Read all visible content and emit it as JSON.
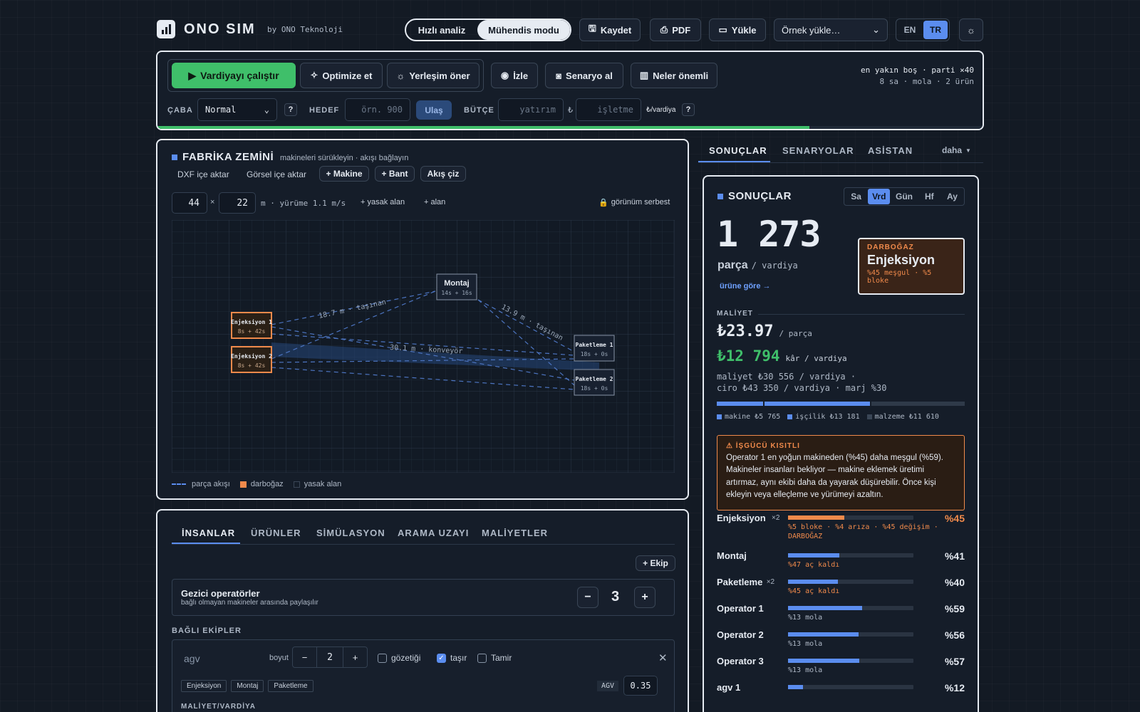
{
  "brand": {
    "name": "ONO SIM",
    "by": "by ONO Teknoloji"
  },
  "mode": {
    "quick": "Hızlı analiz",
    "engineer": "Mühendis modu"
  },
  "top": {
    "save": "Kaydet",
    "pdf": "PDF",
    "load": "Yükle",
    "example": "Örnek yükle…",
    "en": "EN",
    "tr": "TR"
  },
  "toolbar": {
    "run": "Vardiyayı çalıştır",
    "optimize": "Optimize et",
    "layout": "Yerleşim öner",
    "watch": "İzle",
    "snapshot": "Senaryo al",
    "matters": "Neler önemli",
    "info1": "en yakın boş · parti ×40",
    "info2": "8 sa · mola · 2 ürün",
    "progress": 0.79
  },
  "params": {
    "effort_label": "ÇABA",
    "effort": "Normal",
    "help": "?",
    "target_label": "HEDEF",
    "target_ph": "örn. 900",
    "reach": "Ulaş",
    "budget_label": "BÜTÇE",
    "invest_ph": "yatırım",
    "currency": "₺",
    "operate_ph": "işletme",
    "per_shift": "₺/vardiya"
  },
  "floor": {
    "title": "FABRİKA ZEMİNİ",
    "subtitle": "makineleri sürükleyin · akışı bağlayın",
    "dxf": "DXF içe aktar",
    "image": "Görsel içe aktar",
    "add_machine": "+ Makine",
    "add_belt": "+ Bant",
    "draw_flow": "Akış çiz",
    "width": "44",
    "x": "×",
    "height": "22",
    "walk": "m · yürüme 1.1 m/s",
    "forbidden": "+ yasak alan",
    "area": "+ alan",
    "view": "görünüm serbest",
    "machines": [
      {
        "name": "Enjeksiyon 1",
        "time": "8s + 42s"
      },
      {
        "name": "Enjeksiyon 2",
        "time": "8s + 42s"
      },
      {
        "name": "Montaj",
        "time": "14s + 16s"
      },
      {
        "name": "Paketleme 1",
        "time": "18s + 0s"
      },
      {
        "name": "Paketleme 2",
        "time": "18s + 0s"
      }
    ],
    "flows": [
      "18.7 m · taşınan",
      "13.9 m · taşınan",
      "30.1 m · konveyör"
    ],
    "legend": {
      "flow": "parça akışı",
      "bottleneck": "darboğaz",
      "forbidden": "yasak alan"
    }
  },
  "lower": {
    "tabs": [
      "İNSANLAR",
      "ÜRÜNLER",
      "SİMÜLASYON",
      "ARAMA UZAYI",
      "MALİYETLER"
    ],
    "add_team": "+ Ekip",
    "roaming_title": "Gezici operatörler",
    "roaming_sub": "bağlı olmayan makineler arasında paylaşılır",
    "roaming_count": "3",
    "minus": "−",
    "plus": "+",
    "teams_label": "BAĞLI EKİPLER",
    "team_name": "agv",
    "size_label": "boyut",
    "size": "2",
    "supervise": "gözetiği",
    "carry": "taşır",
    "repair": "Tamir",
    "chips": [
      "Enjeksiyon",
      "Montaj",
      "Paketleme"
    ],
    "agv": "AGV",
    "agv_val": "0.35",
    "cost_label": "MALİYET/VARDİYA"
  },
  "right": {
    "tabs": [
      "SONUÇLAR",
      "SENARYOLAR",
      "ASİSTAN"
    ],
    "more": "daha",
    "title": "SONUÇLAR",
    "periods": [
      "Sa",
      "Vrd",
      "Gün",
      "Hf",
      "Ay"
    ],
    "big": "1 273",
    "unit": "parça",
    "per": "/ vardiya",
    "by_product": "ürüne göre →",
    "bottleneck": {
      "label": "DARBOĞAZ",
      "name": "Enjeksiyon",
      "detail": "%45 meşgul · %5 bloke"
    },
    "cost_label": "MALİYET",
    "unit_cost": "₺23.97",
    "unit_cost_per": "/ parça",
    "profit": "₺12 794",
    "profit_per": "kâr / vardiya",
    "line1": "maliyet ₺30 556 / vardiya ·",
    "line2": "ciro ₺43 350 / vardiya · marj %30",
    "costbar": [
      {
        "name": "makine ₺5 765",
        "value": 5765,
        "color": "#5b8def"
      },
      {
        "name": "işçilik ₺13 181",
        "value": 13181,
        "color": "#5b8def"
      },
      {
        "name": "malzeme ₺11 610",
        "value": 11610,
        "color": "#2f3a49"
      }
    ],
    "warn": {
      "title": "⚠ İŞGÜCÜ KISITLI",
      "text": "Operator 1 en yoğun makineden (%45) daha meşgul (%59). Makineler insanları bekliyor — makine eklemek üretimi artırmaz, aynı ekibi daha da yayarak düşürebilir. Önce kişi ekleyin veya elleçleme ve yürümeyi azaltın."
    },
    "util": [
      {
        "name": "Enjeksiyon",
        "mult": "×2",
        "pct": "%45",
        "value": 0.45,
        "note": "%5 bloke · %4 arıza · %45 değişim · DARBOĞAZ",
        "hot": true
      },
      {
        "name": "Montaj",
        "mult": "",
        "pct": "%41",
        "value": 0.41,
        "note": "%47 aç kaldı",
        "hot": false
      },
      {
        "name": "Paketleme",
        "mult": "×2",
        "pct": "%40",
        "value": 0.4,
        "note": "%45 aç kaldı",
        "hot": false
      },
      {
        "name": "Operator 1",
        "mult": "",
        "pct": "%59",
        "value": 0.59,
        "note": "%13 mola",
        "hot": false
      },
      {
        "name": "Operator 2",
        "mult": "",
        "pct": "%56",
        "value": 0.56,
        "note": "%13 mola",
        "hot": false
      },
      {
        "name": "Operator 3",
        "mult": "",
        "pct": "%57",
        "value": 0.57,
        "note": "%13 mola",
        "hot": false
      },
      {
        "name": "agv 1",
        "mult": "",
        "pct": "%12",
        "value": 0.12,
        "note": "",
        "hot": false
      }
    ]
  }
}
